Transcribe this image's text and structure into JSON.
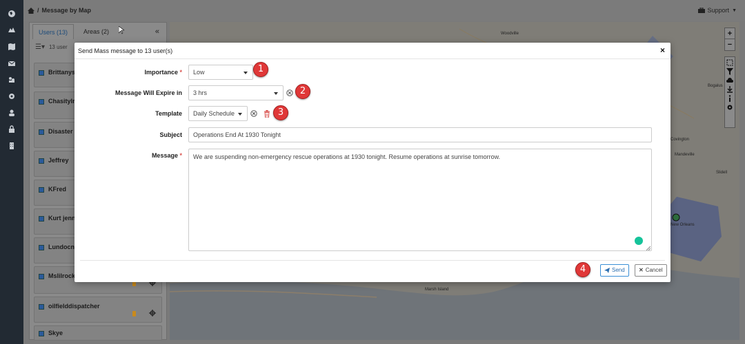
{
  "breadcrumb": {
    "separator": "/",
    "page": "Message by Map"
  },
  "support": {
    "label": "Support"
  },
  "left_panel": {
    "tabs": [
      {
        "label": "Users (13)"
      },
      {
        "label": "Areas (2)"
      }
    ],
    "list_count": "13 user",
    "users": [
      {
        "name": "Brittanys"
      },
      {
        "name": "Chasitylr"
      },
      {
        "name": "Disaster S"
      },
      {
        "name": "Jeffrey"
      },
      {
        "name": "KFred"
      },
      {
        "name": "Kurt jenn"
      },
      {
        "name": "Lundocno"
      },
      {
        "name": "Mslilrock"
      },
      {
        "name": "oilfielddispatcher"
      },
      {
        "name": "Skye"
      }
    ]
  },
  "map": {
    "labels": [
      "Woodville",
      "Covington",
      "Mandeville",
      "Bogalus",
      "New Orleans",
      "Marsh Island",
      "Slidell"
    ],
    "zoom_in": "+",
    "zoom_out": "−"
  },
  "modal": {
    "title": "Send Mass message to 13 user(s)",
    "close": "×",
    "fields": {
      "importance": {
        "label": "Importance",
        "required": "*",
        "value": "Low"
      },
      "expire": {
        "label": "Message Will Expire in",
        "value": "3 hrs"
      },
      "template": {
        "label": "Template",
        "value": "Daily Schedule"
      },
      "subject": {
        "label": "Subject",
        "value": "Operations End At 1930 Tonight"
      },
      "message": {
        "label": "Message",
        "required": "*",
        "value": "We are suspending non-emergency rescue operations at 1930 tonight. Resume operations at sunrise tomorrow."
      }
    },
    "buttons": {
      "send": "Send",
      "cancel": "Cancel"
    }
  },
  "callouts": [
    "1",
    "2",
    "3",
    "4"
  ],
  "colors": {
    "accent": "#3a8fd6",
    "danger": "#e03838",
    "rail": "#222a33"
  }
}
